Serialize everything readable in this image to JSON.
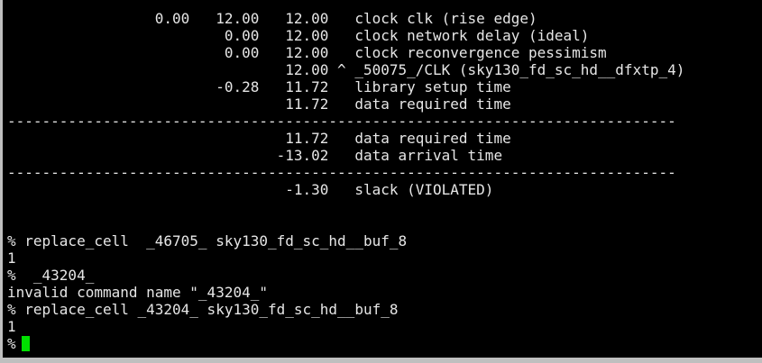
{
  "terminal": {
    "cursor_color": "#00e000",
    "text_color": "#e6e6e6",
    "background_color": "#000000",
    "lines": [
      "                 0.00   12.00   12.00   clock clk (rise edge)",
      "                         0.00   12.00   clock network delay (ideal)",
      "                         0.00   12.00   clock reconvergence pessimism",
      "                                12.00 ^ _50075_/CLK (sky130_fd_sc_hd__dfxtp_4)",
      "                        -0.28   11.72   library setup time",
      "                                11.72   data required time",
      "-----------------------------------------------------------------------------",
      "                                11.72   data required time",
      "                               -13.02   data arrival time",
      "-----------------------------------------------------------------------------",
      "                                -1.30   slack (VIOLATED)",
      "",
      "",
      "% replace_cell  _46705_ sky130_fd_sc_hd__buf_8",
      "1",
      "%  _43204_",
      "invalid command name \"_43204_\"",
      "% replace_cell _43204_ sky130_fd_sc_hd__buf_8",
      "1",
      "%"
    ]
  }
}
